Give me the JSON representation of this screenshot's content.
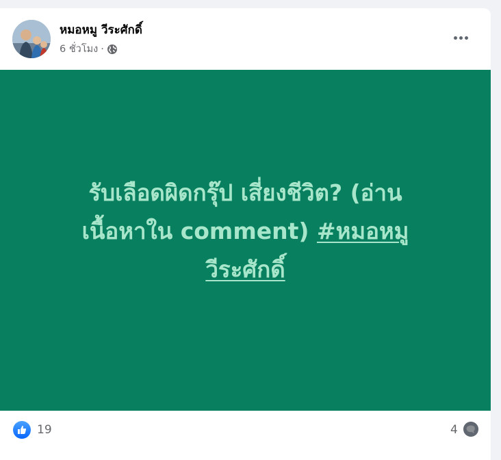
{
  "post": {
    "author": "หมอหมู วีระศักดิ์",
    "time": "6 ชั่วโมง",
    "separator": "·",
    "privacy_icon": "globe-icon",
    "menu_icon": "more-options-icon"
  },
  "banner": {
    "background": "#087f5e",
    "text_color": "#a8e6cb",
    "line1": "รับเลือดผิดกรุ๊ป เสี่ยงชีวิต? (อ่าน",
    "line2": "เนื้อหาใน comment) ",
    "hashtag_part1": "#หมอหมู",
    "hashtag_part2": "วีระศักดิ์"
  },
  "reactions": {
    "like_icon": "like-icon",
    "like_count": "19",
    "comment_count": "4",
    "like_color": "#0866ff"
  }
}
